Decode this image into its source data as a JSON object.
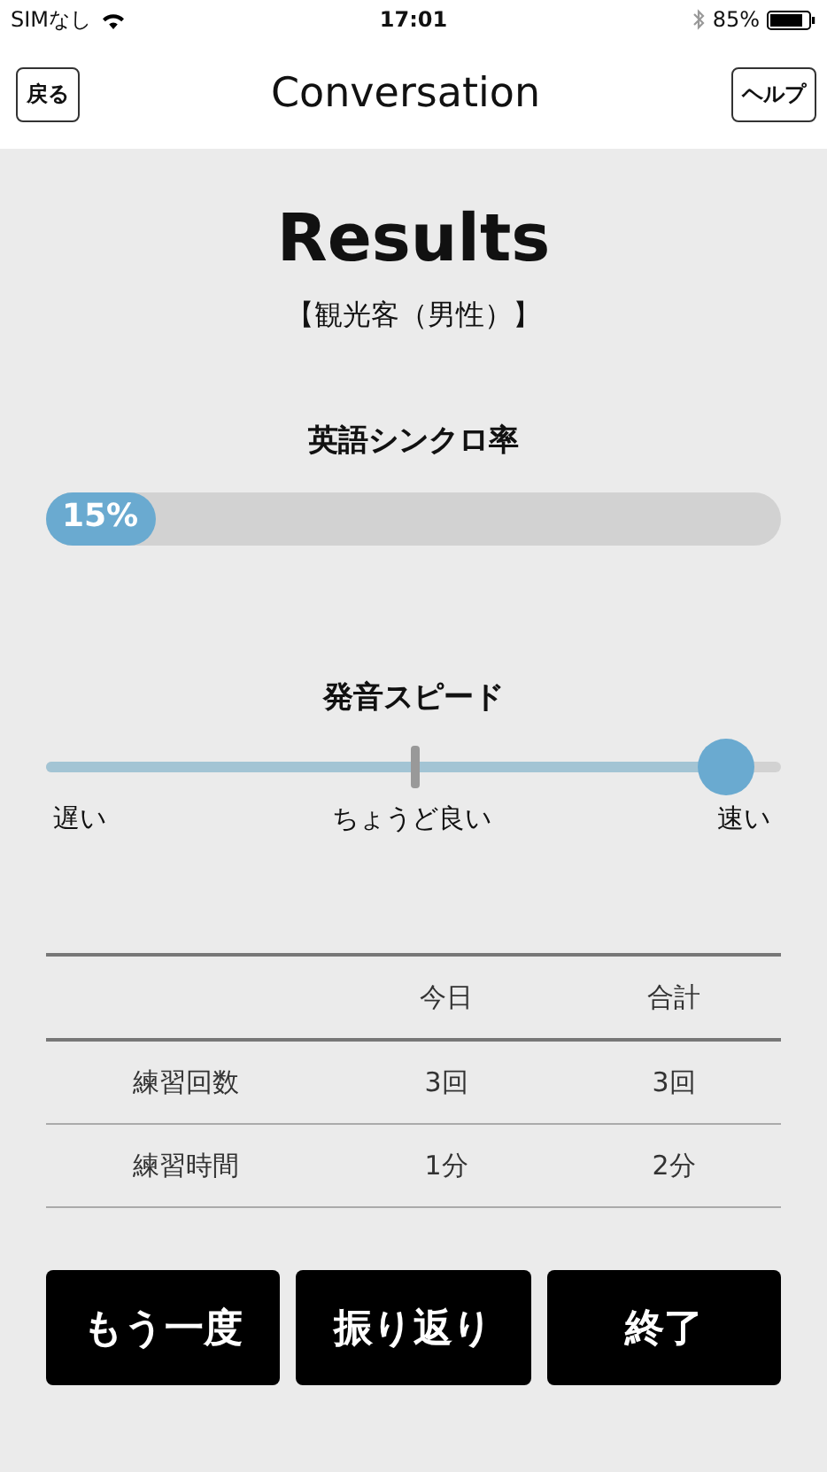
{
  "status_bar": {
    "carrier": "SIMなし",
    "time": "17:01",
    "battery": "85%"
  },
  "nav": {
    "back": "戻る",
    "title": "Conversation",
    "help": "ヘルプ"
  },
  "title": "Results",
  "subtitle": "【観光客（男性）】",
  "sync": {
    "label": "英語シンクロ率",
    "level": 0.15,
    "reading": "15%"
  },
  "speed": {
    "label": "発音スピード",
    "level": 0.925,
    "marks": [
      "遅い",
      "ちょうど良い",
      "速い"
    ]
  },
  "table": {
    "columns": [
      "今日",
      "合計"
    ],
    "rows": [
      {
        "label": "練習回数",
        "cells": [
          "3回",
          "3回"
        ]
      },
      {
        "label": "練習時間",
        "cells": [
          "1分",
          "2分"
        ]
      }
    ]
  },
  "buttons": [
    "もう一度",
    "振り返り",
    "終了"
  ]
}
